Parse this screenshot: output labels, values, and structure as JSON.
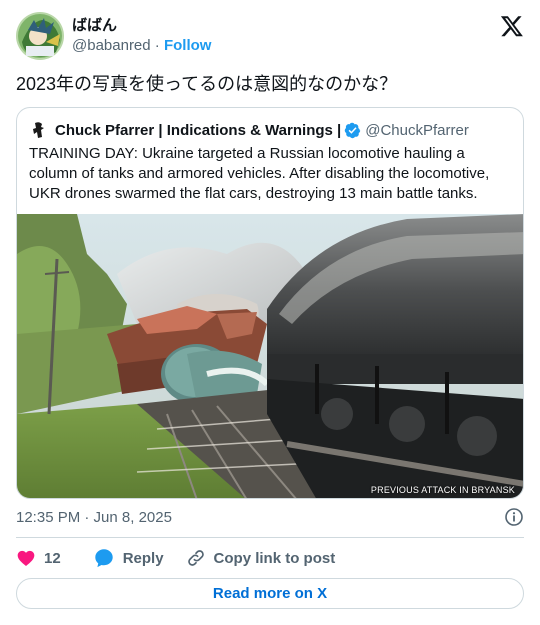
{
  "author": {
    "display_name": "ばばん",
    "handle": "@babanred",
    "separator": "·",
    "follow_label": "Follow"
  },
  "tweet": {
    "text": "2023年の写真を使ってるのは意図的なのかな？"
  },
  "quote": {
    "display_name": "Chuck Pfarrer | Indications & Warnings |",
    "handle": "@ChuckPfarrer",
    "text": "TRAINING DAY:  Ukraine targeted a Russian locomotive hauling a column of tanks and armored vehicles.  After disabling the locomotive, UKR drones swarmed the flat cars, destroying 13 main battle tanks.",
    "media_caption": "PREVIOUS ATTACK IN BRYANSK"
  },
  "meta": {
    "timestamp": "12:35 PM · Jun 8, 2025"
  },
  "actions": {
    "like_count": "12",
    "reply_label": "Reply",
    "copy_link_label": "Copy link to post"
  },
  "footer": {
    "read_more_label": "Read more on X"
  },
  "colors": {
    "accent": "#1d9bf0",
    "like": "#f91880",
    "link": "#006fd6",
    "muted": "#536471",
    "border": "#cfd9de"
  },
  "icons": [
    "x-logo-icon",
    "verified-badge-icon",
    "info-icon",
    "heart-icon",
    "reply-icon",
    "link-icon"
  ]
}
